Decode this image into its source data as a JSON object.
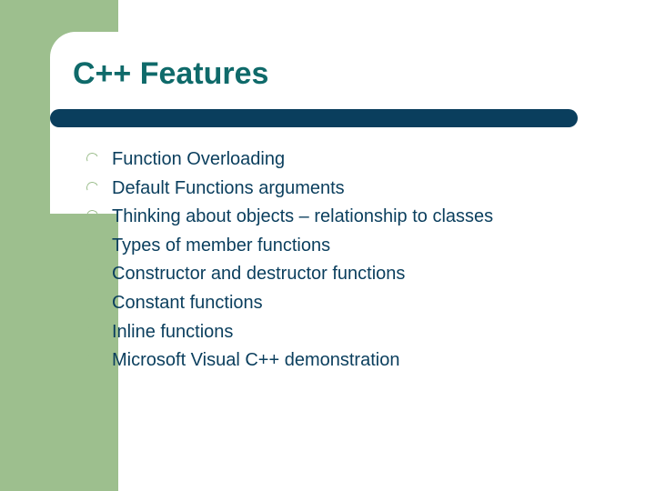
{
  "title": "C++ Features",
  "bullets": [
    "Function Overloading",
    "Default Functions arguments",
    "Thinking about objects – relationship to classes",
    "Types of member functions",
    "Constructor and destructor functions",
    "Constant functions",
    "Inline functions",
    "Microsoft Visual C++ demonstration"
  ]
}
